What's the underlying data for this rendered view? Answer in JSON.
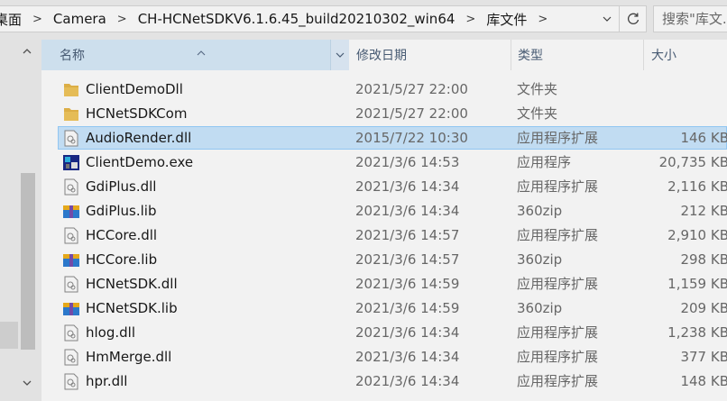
{
  "address": {
    "crumbs": [
      "桌面",
      "Camera",
      "CH-HCNetSDKV6.1.6.45_build20210302_win64",
      "库文件"
    ],
    "separator": ">",
    "search_placeholder": "搜索\"库文..."
  },
  "columns": {
    "name": "名称",
    "date": "修改日期",
    "type": "类型",
    "size": "大小"
  },
  "files": [
    {
      "name": "ClientDemoDll",
      "date": "2021/5/27 22:00",
      "type": "文件夹",
      "size": "",
      "icon": "folder-icon"
    },
    {
      "name": "HCNetSDKCom",
      "date": "2021/5/27 22:00",
      "type": "文件夹",
      "size": "",
      "icon": "folder-icon"
    },
    {
      "name": "AudioRender.dll",
      "date": "2015/7/22 10:30",
      "type": "应用程序扩展",
      "size": "146 KB",
      "icon": "dll-icon",
      "selected": true
    },
    {
      "name": "ClientDemo.exe",
      "date": "2021/3/6 14:53",
      "type": "应用程序",
      "size": "20,735 KB",
      "icon": "exe-icon"
    },
    {
      "name": "GdiPlus.dll",
      "date": "2021/3/6 14:34",
      "type": "应用程序扩展",
      "size": "2,116 KB",
      "icon": "dll-icon"
    },
    {
      "name": "GdiPlus.lib",
      "date": "2021/3/6 14:34",
      "type": "360zip",
      "size": "212 KB",
      "icon": "zip-icon"
    },
    {
      "name": "HCCore.dll",
      "date": "2021/3/6 14:57",
      "type": "应用程序扩展",
      "size": "2,910 KB",
      "icon": "dll-icon"
    },
    {
      "name": "HCCore.lib",
      "date": "2021/3/6 14:57",
      "type": "360zip",
      "size": "298 KB",
      "icon": "zip-icon"
    },
    {
      "name": "HCNetSDK.dll",
      "date": "2021/3/6 14:59",
      "type": "应用程序扩展",
      "size": "1,159 KB",
      "icon": "dll-icon"
    },
    {
      "name": "HCNetSDK.lib",
      "date": "2021/3/6 14:59",
      "type": "360zip",
      "size": "209 KB",
      "icon": "zip-icon"
    },
    {
      "name": "hlog.dll",
      "date": "2021/3/6 14:34",
      "type": "应用程序扩展",
      "size": "1,238 KB",
      "icon": "dll-icon"
    },
    {
      "name": "HmMerge.dll",
      "date": "2021/3/6 14:34",
      "type": "应用程序扩展",
      "size": "377 KB",
      "icon": "dll-icon"
    },
    {
      "name": "hpr.dll",
      "date": "2021/3/6 14:34",
      "type": "应用程序扩展",
      "size": "148 KB",
      "icon": "dll-icon"
    }
  ],
  "colors": {
    "selection_fill": "#cce8ff",
    "selection_border": "#99d1ff",
    "header_active": "#d9ebfa",
    "folder": "#e8b84a"
  }
}
